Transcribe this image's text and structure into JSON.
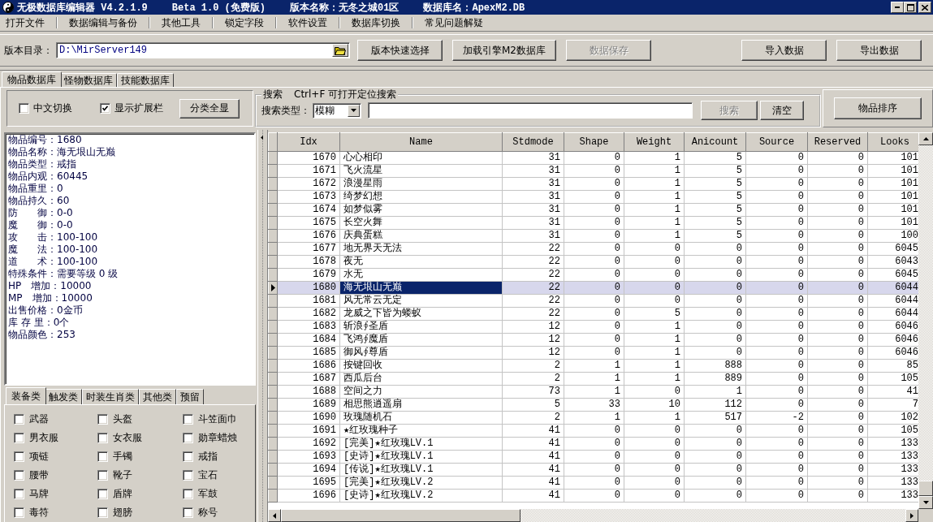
{
  "window": {
    "title_parts": [
      "无极数据库编辑器 V4.2.1.9",
      "Beta 1.0 (免费版)",
      "版本名称：无冬之城01区",
      "数据库名：ApexM2.DB"
    ]
  },
  "menu": [
    "打开文件",
    "数据编辑与备份",
    "其他工具",
    "锁定字段",
    "软件设置",
    "数据库切换",
    "常见问题解疑"
  ],
  "toolbar": {
    "path_label": "版本目录：",
    "path_value": "D:\\MirServer149",
    "buttons": [
      {
        "label": "版本快速选择",
        "disabled": false
      },
      {
        "label": "加载引擎M2数据库",
        "disabled": false
      },
      {
        "label": "数据保存",
        "disabled": true
      }
    ],
    "right_buttons": [
      {
        "label": "导入数据",
        "disabled": false
      },
      {
        "label": "导出数据",
        "disabled": false
      }
    ]
  },
  "tabs": [
    {
      "label": "物品数据库",
      "selected": true
    },
    {
      "label": "怪物数据库",
      "selected": false
    },
    {
      "label": "技能数据库",
      "selected": false
    }
  ],
  "options": {
    "checkboxes": [
      {
        "label": "中文切换",
        "checked": false
      },
      {
        "label": "显示扩展栏",
        "checked": true
      }
    ],
    "button": "分类全显"
  },
  "search": {
    "title": "搜索",
    "hint": "Ctrl+F 可打开定位搜索",
    "type_label": "搜索类型：",
    "type_value": "模糊",
    "buttons": [
      {
        "label": "搜索",
        "disabled": true
      },
      {
        "label": "清空",
        "disabled": false
      }
    ]
  },
  "sort_button": "物品排序",
  "item_info": [
    "物品编号：1680",
    "物品名称：海无垠山无巅",
    "物品类型：戒指",
    "物品内观：60445",
    "物品重里：0",
    "物品持久：60",
    "防　　御：0-0",
    "魔　　御：0-0",
    "攻　　击：100-100",
    "魔　　法：100-100",
    "道　　术：100-100",
    "特殊条件：需要等级 0 级",
    "HP　增加：10000",
    "MP　增加：10000",
    "出售价格：0金币",
    "库 存 里：0个",
    "物品颜色：253"
  ],
  "categories": {
    "tabs": [
      {
        "label": "装备类",
        "selected": true
      },
      {
        "label": "触发类",
        "selected": false
      },
      {
        "label": "时装生肖类",
        "selected": false
      },
      {
        "label": "其他类",
        "selected": false
      },
      {
        "label": "预留",
        "selected": false
      }
    ],
    "checkboxes": [
      {
        "label": "武器",
        "checked": false
      },
      {
        "label": "头盔",
        "checked": false
      },
      {
        "label": "斗笠面巾",
        "checked": false
      },
      {
        "label": "男衣服",
        "checked": false
      },
      {
        "label": "女衣服",
        "checked": false
      },
      {
        "label": "勋章蜡烛",
        "checked": false
      },
      {
        "label": "项链",
        "checked": false
      },
      {
        "label": "手镯",
        "checked": false
      },
      {
        "label": "戒指",
        "checked": false
      },
      {
        "label": "腰带",
        "checked": false
      },
      {
        "label": "靴子",
        "checked": false
      },
      {
        "label": "宝石",
        "checked": false
      },
      {
        "label": "马牌",
        "checked": false
      },
      {
        "label": "盾牌",
        "checked": false
      },
      {
        "label": "军鼓",
        "checked": false
      },
      {
        "label": "毒符",
        "checked": false
      },
      {
        "label": "翅膀",
        "checked": false
      },
      {
        "label": "称号",
        "checked": false
      }
    ]
  },
  "table": {
    "columns": [
      {
        "label": "Idx",
        "kind": "number",
        "focused": false
      },
      {
        "label": "Name",
        "kind": "text",
        "focused": true
      },
      {
        "label": "Stdmode",
        "kind": "number",
        "focused": false
      },
      {
        "label": "Shape",
        "kind": "number",
        "focused": false
      },
      {
        "label": "Weight",
        "kind": "number",
        "focused": false
      },
      {
        "label": "Anicount",
        "kind": "number",
        "focused": false
      },
      {
        "label": "Source",
        "kind": "number",
        "focused": false
      },
      {
        "label": "Reserved",
        "kind": "number",
        "focused": false
      },
      {
        "label": "Looks",
        "kind": "number",
        "focused": false
      }
    ],
    "rows": [
      {
        "cells": [
          "1670",
          "心心相印",
          "31",
          "0",
          "1",
          "5",
          "0",
          "0",
          "101"
        ],
        "selected": false
      },
      {
        "cells": [
          "1671",
          "飞火流星",
          "31",
          "0",
          "1",
          "5",
          "0",
          "0",
          "101"
        ],
        "selected": false
      },
      {
        "cells": [
          "1672",
          "浪漫星雨",
          "31",
          "0",
          "1",
          "5",
          "0",
          "0",
          "101"
        ],
        "selected": false
      },
      {
        "cells": [
          "1673",
          "绮梦幻想",
          "31",
          "0",
          "1",
          "5",
          "0",
          "0",
          "101"
        ],
        "selected": false
      },
      {
        "cells": [
          "1674",
          "如梦似雾",
          "31",
          "0",
          "1",
          "5",
          "0",
          "0",
          "101"
        ],
        "selected": false
      },
      {
        "cells": [
          "1675",
          "长空火舞",
          "31",
          "0",
          "1",
          "5",
          "0",
          "0",
          "101"
        ],
        "selected": false
      },
      {
        "cells": [
          "1676",
          "庆典蛋糕",
          "31",
          "0",
          "1",
          "5",
          "0",
          "0",
          "100"
        ],
        "selected": false
      },
      {
        "cells": [
          "1677",
          "地无界天无法",
          "22",
          "0",
          "0",
          "0",
          "0",
          "0",
          "6045"
        ],
        "selected": false
      },
      {
        "cells": [
          "1678",
          "夜无",
          "22",
          "0",
          "0",
          "0",
          "0",
          "0",
          "6043"
        ],
        "selected": false
      },
      {
        "cells": [
          "1679",
          "水无",
          "22",
          "0",
          "0",
          "0",
          "0",
          "0",
          "6045"
        ],
        "selected": false
      },
      {
        "cells": [
          "1680",
          "海无垠山无巅",
          "22",
          "0",
          "0",
          "0",
          "0",
          "0",
          "6044"
        ],
        "selected": true
      },
      {
        "cells": [
          "1681",
          "风无常云无定",
          "22",
          "0",
          "0",
          "0",
          "0",
          "0",
          "6044"
        ],
        "selected": false
      },
      {
        "cells": [
          "1682",
          "龙威之下皆为蝼蚁",
          "22",
          "0",
          "5",
          "0",
          "0",
          "0",
          "6044"
        ],
        "selected": false
      },
      {
        "cells": [
          "1683",
          "斩浪∮圣盾",
          "12",
          "0",
          "1",
          "0",
          "0",
          "0",
          "6046"
        ],
        "selected": false
      },
      {
        "cells": [
          "1684",
          "飞鸿∮魔盾",
          "12",
          "0",
          "1",
          "0",
          "0",
          "0",
          "6046"
        ],
        "selected": false
      },
      {
        "cells": [
          "1685",
          "御风∮尊盾",
          "12",
          "0",
          "1",
          "0",
          "0",
          "0",
          "6046"
        ],
        "selected": false
      },
      {
        "cells": [
          "1686",
          "按键回收",
          "2",
          "1",
          "1",
          "888",
          "0",
          "0",
          "85"
        ],
        "selected": false
      },
      {
        "cells": [
          "1687",
          "西瓜后台",
          "2",
          "1",
          "1",
          "889",
          "0",
          "0",
          "105"
        ],
        "selected": false
      },
      {
        "cells": [
          "1688",
          "空间之力",
          "73",
          "1",
          "0",
          "1",
          "0",
          "0",
          "41"
        ],
        "selected": false
      },
      {
        "cells": [
          "1689",
          "相思熊逍遥扇",
          "5",
          "33",
          "10",
          "112",
          "0",
          "0",
          "7"
        ],
        "selected": false
      },
      {
        "cells": [
          "1690",
          "玫瑰随机石",
          "2",
          "1",
          "1",
          "517",
          "-2",
          "0",
          "102"
        ],
        "selected": false
      },
      {
        "cells": [
          "1691",
          "★红玫瑰种子",
          "41",
          "0",
          "0",
          "0",
          "0",
          "0",
          "105"
        ],
        "selected": false
      },
      {
        "cells": [
          "1692",
          "[完美]★红玫瑰LV.1",
          "41",
          "0",
          "0",
          "0",
          "0",
          "0",
          "133"
        ],
        "selected": false
      },
      {
        "cells": [
          "1693",
          "[史诗]★红玫瑰LV.1",
          "41",
          "0",
          "0",
          "0",
          "0",
          "0",
          "133"
        ],
        "selected": false
      },
      {
        "cells": [
          "1694",
          "[传说]★红玫瑰LV.1",
          "41",
          "0",
          "0",
          "0",
          "0",
          "0",
          "133"
        ],
        "selected": false
      },
      {
        "cells": [
          "1695",
          "[完美]★红玫瑰LV.2",
          "41",
          "0",
          "0",
          "0",
          "0",
          "0",
          "133"
        ],
        "selected": false
      },
      {
        "cells": [
          "1696",
          "[史诗]★红玫瑰LV.2",
          "41",
          "0",
          "0",
          "0",
          "0",
          "0",
          "133"
        ],
        "selected": false
      }
    ]
  }
}
